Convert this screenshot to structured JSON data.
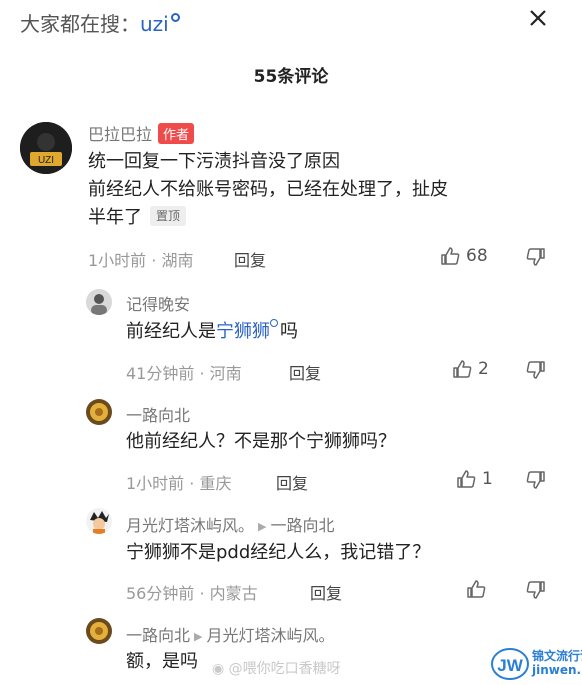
{
  "search": {
    "prefix": "大家都在搜：",
    "keyword": "uzi"
  },
  "comments_title": "55条评论",
  "comments": [
    {
      "user": "巴拉巴拉",
      "author_badge": "作者",
      "lines": [
        "统一回复一下污渍抖音没了原因",
        "前经纪人不给账号密码，已经在处理了，扯皮",
        "半年了"
      ],
      "pin_badge": "置顶",
      "time_location": "1小时前 · 湖南",
      "reply": "回复",
      "likes": "68"
    },
    {
      "user": "记得晚安",
      "text_before": "前经纪人是",
      "text_link": "宁狮狮",
      "text_after": "吗",
      "time_location": "41分钟前 · 河南",
      "reply": "回复",
      "likes": "2"
    },
    {
      "user": "一路向北",
      "text": "他前经纪人？不是那个宁狮狮吗？",
      "time_location": "1小时前 · 重庆",
      "reply": "回复",
      "likes": "1"
    },
    {
      "user": "月光灯塔沐屿风。",
      "reply_to": "一路向北",
      "text": "宁狮狮不是pdd经纪人么，我记错了？",
      "time_location": "56分钟前 · 内蒙古",
      "reply": "回复",
      "likes": ""
    },
    {
      "user": "一路向北",
      "reply_to": "月光灯塔沐屿风。",
      "text": "额，是吗"
    }
  ],
  "watermark": {
    "weibo": "@喂你吃口香糖呀",
    "site_cn": "锦文流行语",
    "site_en": "jinwen.net"
  },
  "colors": {
    "link": "#2b63c4",
    "author_badge": "#ef4b4b",
    "brand": "#2a7fd4"
  }
}
